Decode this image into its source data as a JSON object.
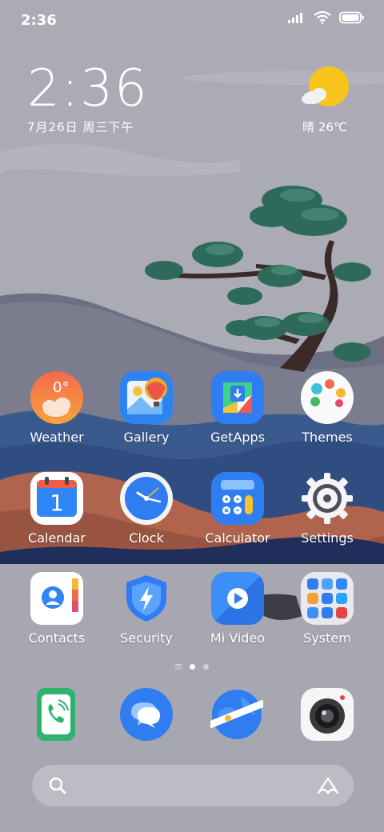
{
  "status": {
    "time": "2:36"
  },
  "clock": {
    "time": "2:36",
    "date": "7月26日 周三下午"
  },
  "weather": {
    "text": "晴 26℃"
  },
  "apps": [
    {
      "label": "Weather",
      "badge": "0°"
    },
    {
      "label": "Gallery"
    },
    {
      "label": "GetApps"
    },
    {
      "label": "Themes"
    },
    {
      "label": "Calendar",
      "badge": "1"
    },
    {
      "label": "Clock"
    },
    {
      "label": "Calculator"
    },
    {
      "label": "Settings"
    },
    {
      "label": "Contacts"
    },
    {
      "label": "Security"
    },
    {
      "label": "Mi Video"
    },
    {
      "label": "System"
    }
  ],
  "dock": [
    "Phone",
    "Messaging",
    "Browser",
    "Camera"
  ],
  "colors": {
    "accent_yellow": "#f7c51c",
    "security_blue": "#2f7cf4"
  }
}
